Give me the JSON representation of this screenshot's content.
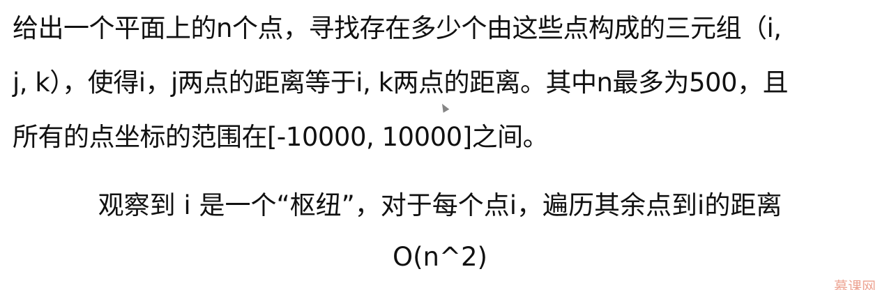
{
  "problem": {
    "line1": "给出一个平面上的n个点，寻找存在多少个由这些点构成的三元组（i,",
    "line2": "j, k），使得i，j两点的距离等于i, k两点的距离。其中n最多为500，且",
    "line3": "所有的点坐标的范围在[-10000, 10000]之间。"
  },
  "observation": {
    "insight": "观察到 i 是一个“枢纽”，对于每个点i，遍历其余点到i的距离",
    "complexity": "O(n^2)"
  },
  "watermark": "慕课网"
}
